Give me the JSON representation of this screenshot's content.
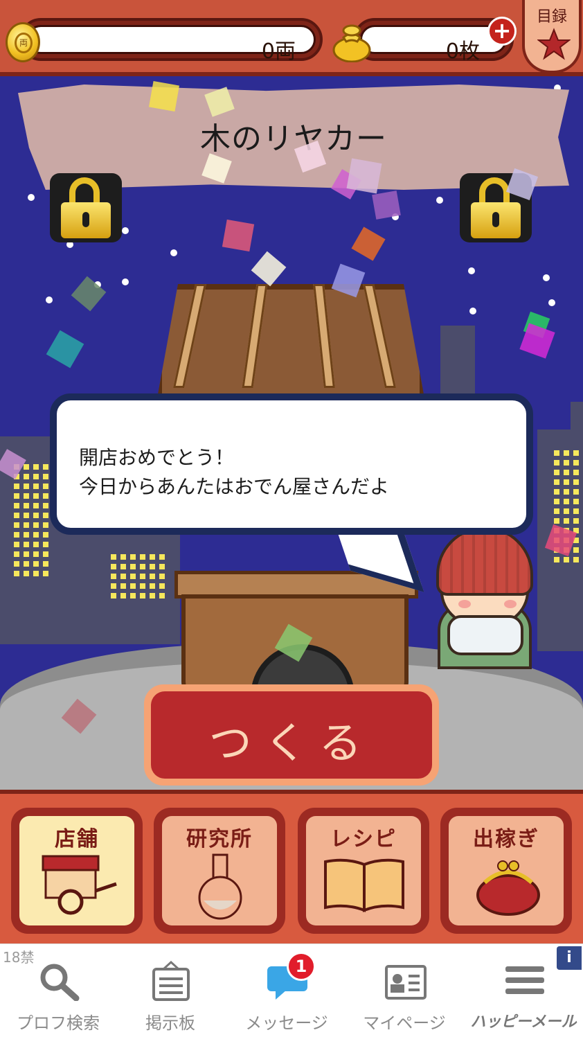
{
  "status": {
    "ryo": "0両",
    "coins": "0枚",
    "catalog_label": "目録"
  },
  "sign": {
    "title": "木のリヤカー"
  },
  "speech": {
    "text": "開店おめでとう！\n今日からあんたはおでん屋さんだよ"
  },
  "actions": {
    "make_label": "つくる"
  },
  "menu": {
    "items": [
      {
        "label": "店舗",
        "icon": "cart-icon"
      },
      {
        "label": "研究所",
        "icon": "flask-icon"
      },
      {
        "label": "レシピ",
        "icon": "book-icon"
      },
      {
        "label": "出稼ぎ",
        "icon": "purse-icon"
      }
    ]
  },
  "ad_nav": {
    "age_label": "18禁",
    "items": [
      {
        "label": "プロフ検索",
        "icon": "search-icon"
      },
      {
        "label": "掲示板",
        "icon": "bulletin-board-icon"
      },
      {
        "label": "メッセージ",
        "icon": "message-icon"
      },
      {
        "label": "マイページ",
        "icon": "profile-card-icon"
      },
      {
        "label": "ハッピーメール",
        "icon": "menu-icon"
      }
    ],
    "message_badge": "1",
    "info_label": "i"
  }
}
